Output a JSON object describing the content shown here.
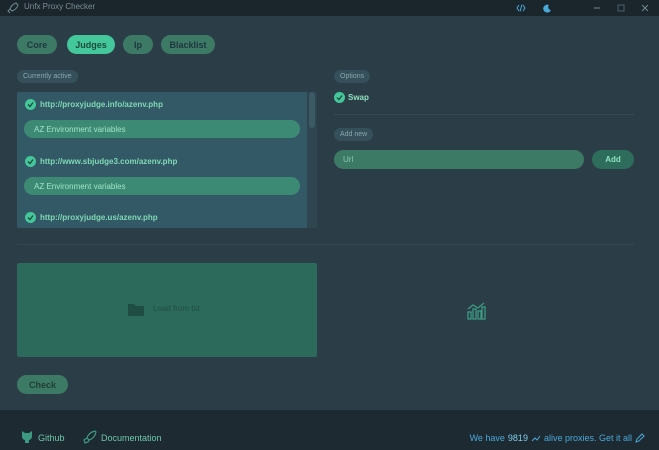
{
  "window": {
    "title": "Unfx Proxy Checker"
  },
  "tabs": [
    {
      "label": "Core",
      "active": false
    },
    {
      "label": "Judges",
      "active": true
    },
    {
      "label": "Ip",
      "active": false
    },
    {
      "label": "Blacklist",
      "active": false
    }
  ],
  "judges": {
    "section_label": "Currently active",
    "items": [
      {
        "url": "http://proxyjudge.info/azenv.php",
        "tag": "AZ Environment variables",
        "checked": true
      },
      {
        "url": "http://www.sbjudge3.com/azenv.php",
        "tag": "AZ Environment variables",
        "checked": true
      },
      {
        "url": "http://proxyjudge.us/azenv.php",
        "checked": true
      }
    ]
  },
  "options": {
    "section_label": "Options",
    "swap_label": "Swap",
    "swap_checked": true
  },
  "add_new": {
    "section_label": "Add new",
    "url_placeholder": "Url",
    "add_label": "Add"
  },
  "load": {
    "dropzone_label": "Load from txt"
  },
  "actions": {
    "check_label": "Check"
  },
  "footer": {
    "github_label": "Github",
    "documentation_label": "Documentation",
    "alive_prefix": "We have",
    "alive_count": "9819",
    "alive_suffix": "alive proxies. Get it all"
  },
  "colors": {
    "accent": "#44c79a",
    "background": "#2b3e48",
    "footer_link": "#4aa8d8"
  }
}
